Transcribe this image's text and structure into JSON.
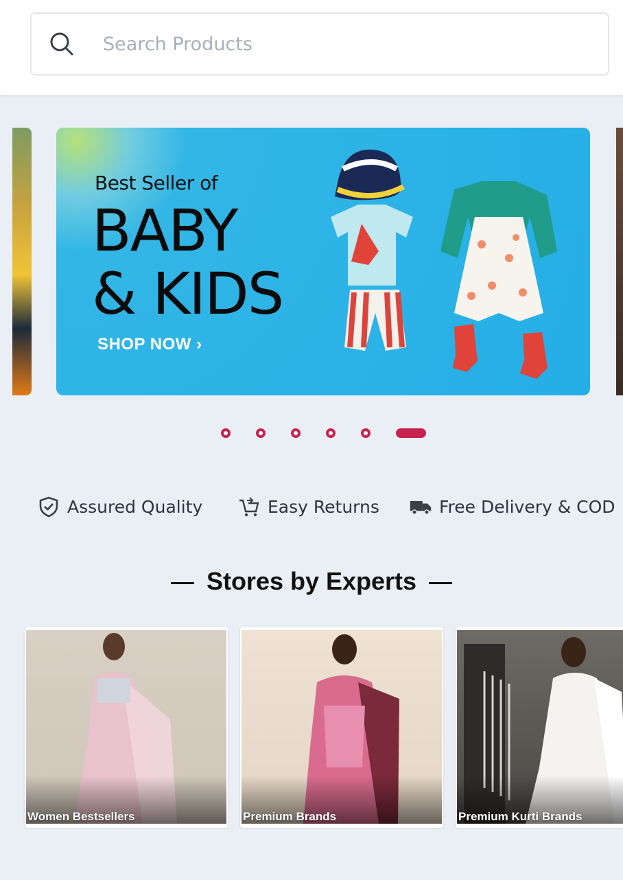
{
  "search": {
    "placeholder": "Search Products"
  },
  "banner": {
    "subtitle": "Best Seller of",
    "title_line1": "BABY",
    "title_line2": "& KIDS",
    "cta": "SHOP NOW ›"
  },
  "carousel": {
    "slide_count": 6,
    "active_index": 5
  },
  "features": [
    {
      "icon": "shield-check-icon",
      "label": "Assured Quality"
    },
    {
      "icon": "cart-return-icon",
      "label": "Easy Returns"
    },
    {
      "icon": "delivery-truck-icon",
      "label": "Free Delivery & COD"
    }
  ],
  "stores_section": {
    "title": "Stores by Experts",
    "cards": [
      {
        "label": "Women Bestsellers"
      },
      {
        "label": "Premium Brands"
      },
      {
        "label": "Premium Kurti Brands"
      }
    ]
  },
  "colors": {
    "accent": "#c8234e",
    "banner_bg": "#25aee6",
    "page_bg": "#eaeff5"
  }
}
